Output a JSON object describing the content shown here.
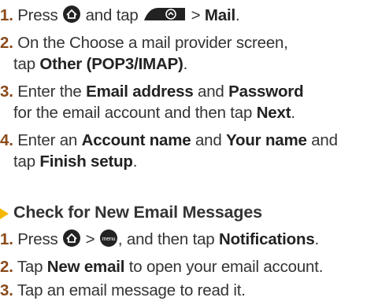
{
  "setup_steps": [
    {
      "num": "1.",
      "text_a": "Press",
      "text_b": "and tap",
      "text_c": ">",
      "bold": "Mail",
      "end": "."
    },
    {
      "num": "2.",
      "line1": "On the Choose a mail provider screen,",
      "line2_a": "tap",
      "line2_bold": "Other (POP3/IMAP)",
      "line2_end": "."
    },
    {
      "num": "3.",
      "line1_a": "Enter the",
      "line1_bold1": "Email address",
      "line1_b": "and",
      "line1_bold2": "Password",
      "line2_a": "for the email account and then tap",
      "line2_bold": "Next",
      "line2_end": "."
    },
    {
      "num": "4.",
      "line1_a": "Enter an",
      "line1_bold1": "Account name",
      "line1_b": "and",
      "line1_bold2": "Your name",
      "line1_c": "and",
      "line2_a": "tap",
      "line2_bold": "Finish setup",
      "line2_end": "."
    }
  ],
  "section_heading": "Check for New Email Messages",
  "check_steps": [
    {
      "num": "1.",
      "text_a": "Press",
      "text_b": ">",
      "text_c": ", and then tap",
      "bold": "Notifications",
      "end": "."
    },
    {
      "num": "2.",
      "text_a": "Tap",
      "bold": "New email",
      "text_b": "to open your email account."
    },
    {
      "num": "3.",
      "text_a": "Tap an email message to read it."
    }
  ],
  "icons": {
    "home": "home-key-icon",
    "slider": "tab-slider-icon",
    "menu": "menu-key-icon",
    "menu_text": "menu"
  },
  "colors": {
    "step_number": "#8a4a1a",
    "arrow": "#f5b800",
    "icon": "#222222"
  }
}
